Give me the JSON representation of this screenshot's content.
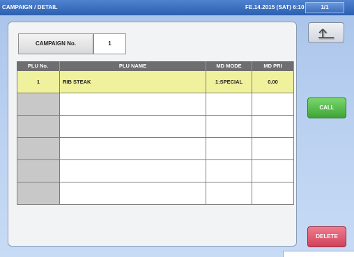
{
  "header": {
    "title": "CAMPAIGN / DETAIL",
    "datetime": "FE.14.2015 (SAT)  6:10",
    "page": "1/1"
  },
  "campaign": {
    "label": "CAMPAIGN No.",
    "value": "1"
  },
  "table": {
    "columns": [
      "PLU No.",
      "PLU NAME",
      "MD MODE",
      "MD PRI"
    ],
    "rows": [
      {
        "no": "1",
        "name": "RIB STEAK",
        "mode": "1:SPECIAL",
        "pri": "0.00"
      },
      {
        "no": "",
        "name": "",
        "mode": "",
        "pri": ""
      },
      {
        "no": "",
        "name": "",
        "mode": "",
        "pri": ""
      },
      {
        "no": "",
        "name": "",
        "mode": "",
        "pri": ""
      },
      {
        "no": "",
        "name": "",
        "mode": "",
        "pri": ""
      },
      {
        "no": "",
        "name": "",
        "mode": "",
        "pri": ""
      }
    ]
  },
  "buttons": {
    "back_icon": "return-arrow-icon",
    "call": "CALL",
    "delete": "DELETE"
  },
  "colors": {
    "header": "#2c5faf",
    "selected_row": "#f0f19c",
    "call": "#3ea436",
    "delete": "#d0425b"
  }
}
